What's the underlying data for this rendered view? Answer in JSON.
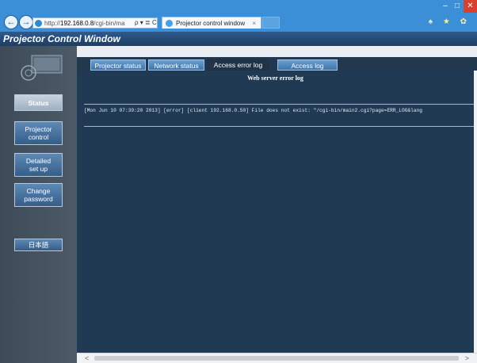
{
  "browser": {
    "address_prefix": "http://",
    "address_host": "192.168.0.8",
    "address_path": "/cgi-bin/ma",
    "address_tools": "ρ ▾ ≣ Ċ",
    "tab_title": "Projector control window",
    "tab_close": "×",
    "back": "←",
    "forward": "→",
    "right_tools": "♠ ★ ✿",
    "min": "–",
    "max": "□",
    "close": "✕"
  },
  "page": {
    "title": "Projector Control Window"
  },
  "sidebar": {
    "items": [
      {
        "label": "Status"
      },
      {
        "label": "Projector\ncontrol"
      },
      {
        "label": "Detailed\nset up"
      },
      {
        "label": "Change\npassword"
      },
      {
        "label": "日本語"
      }
    ]
  },
  "tabs": [
    {
      "label": "Projector status"
    },
    {
      "label": "Network status"
    },
    {
      "label": "Access error log"
    },
    {
      "label": "Access log"
    }
  ],
  "content": {
    "heading": "Web server error log",
    "log_entry": "[Mon Jun 10 07:39:20 2013] [error] [client 192.168.0.50] File does not exist: \"/cgi-bin/main2.cgi?page=ERR_LOG&lang"
  },
  "scroll": {
    "left_arrow": "<",
    "right_arrow": ">"
  }
}
